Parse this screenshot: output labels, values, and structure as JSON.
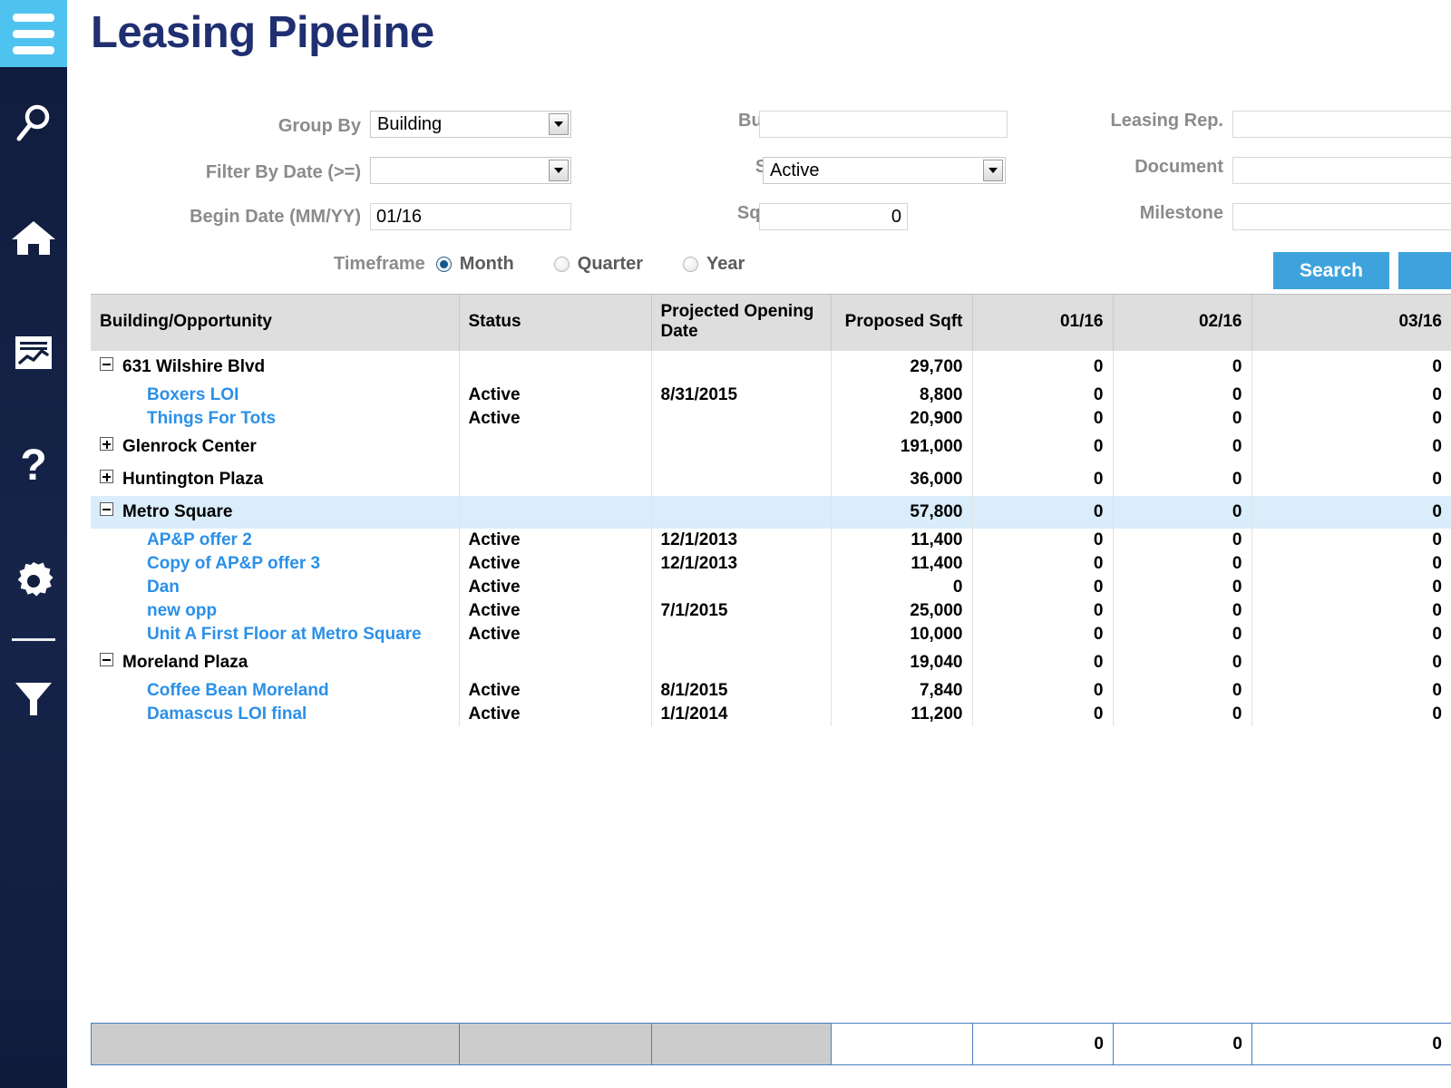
{
  "app": {
    "title": "Leasing Pipeline"
  },
  "sidebar": {
    "menu_icon": "hamburger-icon",
    "items": [
      {
        "icon": "search-icon",
        "name": "search"
      },
      {
        "icon": "home-icon",
        "name": "home"
      },
      {
        "icon": "report-icon",
        "name": "reports"
      },
      {
        "icon": "question-mark-icon",
        "name": "help"
      },
      {
        "icon": "gear-icon",
        "name": "settings"
      },
      {
        "icon": "funnel-icon",
        "name": "filter"
      }
    ]
  },
  "filters": {
    "group_by": {
      "label": "Group By",
      "value": "Building"
    },
    "filter_by_date": {
      "label": "Filter By Date (>=)",
      "value": ""
    },
    "begin_date": {
      "label": "Begin Date (MM/YY)",
      "value": "01/16"
    },
    "building": {
      "label": "Building",
      "value": ""
    },
    "status": {
      "label": "Status",
      "value": "Active"
    },
    "sqft": {
      "label": "Sqft (>=)",
      "value": "0"
    },
    "leasing_rep": {
      "label": "Leasing Rep.",
      "value": ""
    },
    "document": {
      "label": "Document",
      "value": ""
    },
    "milestone": {
      "label": "Milestone",
      "value": ""
    },
    "timeframe": {
      "label": "Timeframe",
      "selected": "Month",
      "options": [
        "Month",
        "Quarter",
        "Year"
      ]
    },
    "search_button": "Search"
  },
  "table": {
    "columns": [
      "Building/Opportunity",
      "Status",
      "Projected Opening Date",
      "Proposed Sqft",
      "01/16",
      "02/16",
      "03/16"
    ],
    "rows": [
      {
        "type": "group",
        "expanded": true,
        "name": "631 Wilshire Blvd",
        "status": "",
        "date": "",
        "sqft": "29,700",
        "m1": "0",
        "m2": "0",
        "m3": "0",
        "highlight": false
      },
      {
        "type": "child",
        "name": "Boxers LOI",
        "status": "Active",
        "date": "8/31/2015",
        "sqft": "8,800",
        "m1": "0",
        "m2": "0",
        "m3": "0",
        "highlight": false
      },
      {
        "type": "child",
        "name": "Things For Tots",
        "status": "Active",
        "date": "",
        "sqft": "20,900",
        "m1": "0",
        "m2": "0",
        "m3": "0",
        "highlight": false
      },
      {
        "type": "group",
        "expanded": false,
        "name": "Glenrock Center",
        "status": "",
        "date": "",
        "sqft": "191,000",
        "m1": "0",
        "m2": "0",
        "m3": "0",
        "highlight": false
      },
      {
        "type": "group",
        "expanded": false,
        "name": "Huntington Plaza",
        "status": "",
        "date": "",
        "sqft": "36,000",
        "m1": "0",
        "m2": "0",
        "m3": "0",
        "highlight": false
      },
      {
        "type": "group",
        "expanded": true,
        "name": "Metro Square",
        "status": "",
        "date": "",
        "sqft": "57,800",
        "m1": "0",
        "m2": "0",
        "m3": "0",
        "highlight": true
      },
      {
        "type": "child",
        "name": "AP&P offer 2",
        "status": "Active",
        "date": "12/1/2013",
        "sqft": "11,400",
        "m1": "0",
        "m2": "0",
        "m3": "0",
        "highlight": false
      },
      {
        "type": "child",
        "name": "Copy of AP&P offer 3",
        "status": "Active",
        "date": "12/1/2013",
        "sqft": "11,400",
        "m1": "0",
        "m2": "0",
        "m3": "0",
        "highlight": false
      },
      {
        "type": "child",
        "name": "Dan",
        "status": "Active",
        "date": "",
        "sqft": "0",
        "m1": "0",
        "m2": "0",
        "m3": "0",
        "highlight": false
      },
      {
        "type": "child",
        "name": "new opp",
        "status": "Active",
        "date": "7/1/2015",
        "sqft": "25,000",
        "m1": "0",
        "m2": "0",
        "m3": "0",
        "highlight": false
      },
      {
        "type": "child",
        "name": "Unit A First Floor at Metro Square",
        "status": "Active",
        "date": "",
        "sqft": "10,000",
        "m1": "0",
        "m2": "0",
        "m3": "0",
        "highlight": false
      },
      {
        "type": "group",
        "expanded": true,
        "name": "Moreland Plaza",
        "status": "",
        "date": "",
        "sqft": "19,040",
        "m1": "0",
        "m2": "0",
        "m3": "0",
        "highlight": false
      },
      {
        "type": "child",
        "name": "Coffee Bean Moreland",
        "status": "Active",
        "date": "8/1/2015",
        "sqft": "7,840",
        "m1": "0",
        "m2": "0",
        "m3": "0",
        "highlight": false
      },
      {
        "type": "child",
        "name": "Damascus LOI final",
        "status": "Active",
        "date": "1/1/2014",
        "sqft": "11,200",
        "m1": "0",
        "m2": "0",
        "m3": "0",
        "highlight": false
      }
    ],
    "totals": {
      "c1": "",
      "c2": "",
      "c3": "",
      "sqft": "",
      "m1": "0",
      "m2": "0",
      "m3": "0"
    }
  },
  "colors": {
    "accent": "#3ea3dc",
    "sidebar": "#111e3e",
    "menu": "#4ec3f0",
    "title": "#1f2f71",
    "link": "#2b90e8",
    "highlight_row": "#d9edfa",
    "header_bg": "#dedede"
  }
}
